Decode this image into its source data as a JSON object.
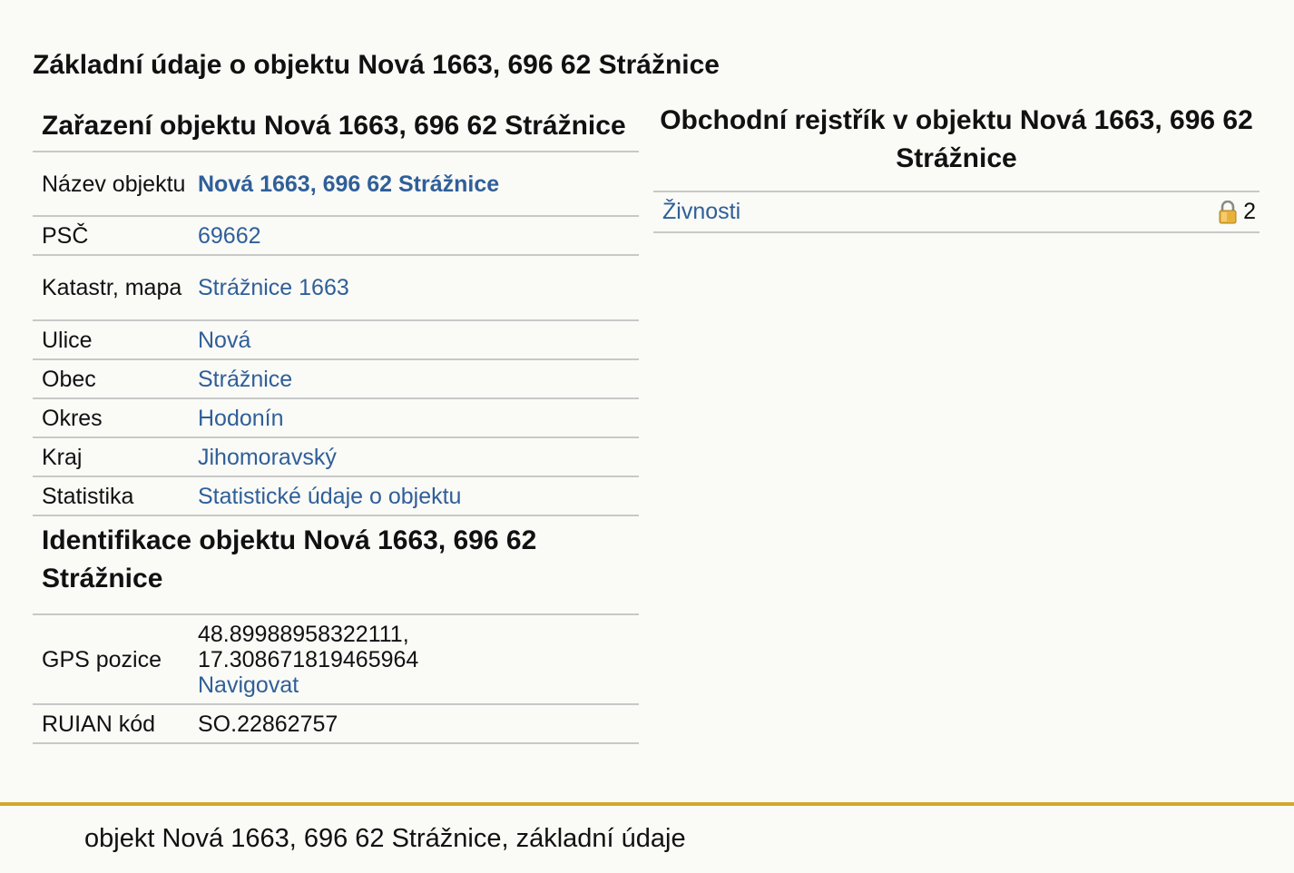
{
  "page": {
    "title": "Základní údaje o objektu Nová 1663, 696 62 Strážnice"
  },
  "classification": {
    "heading": "Zařazení objektu Nová 1663, 696 62 Strážnice",
    "rows": [
      {
        "label": "Název objektu",
        "value": "Nová 1663, 696 62 Strážnice"
      },
      {
        "label": "PSČ",
        "value": "69662"
      },
      {
        "label": "Katastr, mapa",
        "value": "Strážnice 1663"
      },
      {
        "label": "Ulice",
        "value": "Nová"
      },
      {
        "label": "Obec",
        "value": "Strážnice"
      },
      {
        "label": "Okres",
        "value": "Hodonín"
      },
      {
        "label": "Kraj",
        "value": "Jihomoravský"
      },
      {
        "label": "Statistika",
        "value": "Statistické údaje o objektu"
      }
    ]
  },
  "identification": {
    "heading": "Identifikace objektu Nová 1663, 696 62 Strážnice",
    "gps_label": "GPS pozice",
    "gps_lat": "48.89988958322111,",
    "gps_lon": "17.308671819465964",
    "navigate_label": "Navigovat",
    "ruian_label": "RUIAN kód",
    "ruian_value": "SO.22862757"
  },
  "business_register": {
    "heading": "Obchodní rejstřík v objektu Nová 1663, 696 62 Strážnice",
    "rows": [
      {
        "label": "Živnosti",
        "count": "2",
        "icon": "lock-icon"
      }
    ]
  },
  "footer": {
    "text": "objekt Nová 1663, 696 62 Strážnice, základní údaje"
  },
  "colors": {
    "link": "#2f5f98",
    "footer_border": "#d4a62a",
    "background": "#fafaf7"
  }
}
